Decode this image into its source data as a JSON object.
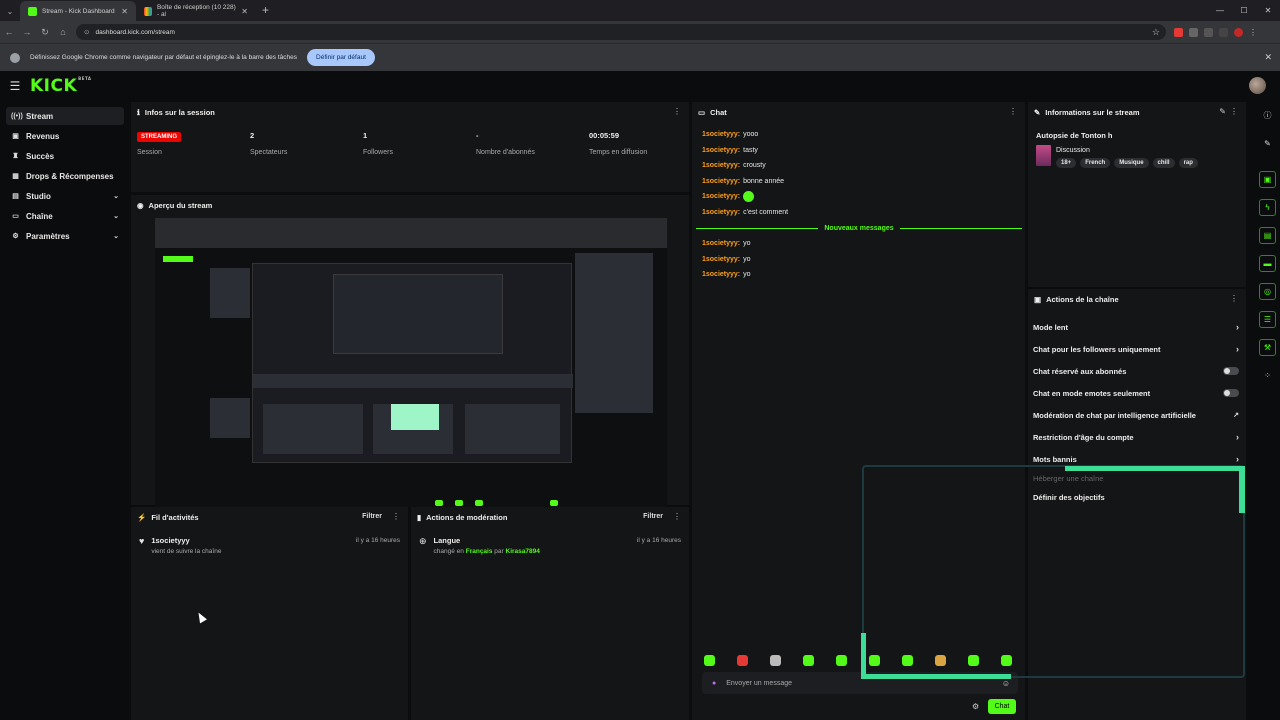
{
  "browser": {
    "tabs": [
      {
        "title": "Stream - Kick Dashboard",
        "active": true
      },
      {
        "title": "Boîte de réception (10 228) - al",
        "active": false
      }
    ],
    "url": "dashboard.kick.com/stream",
    "infobar_text": "Définissez Google Chrome comme navigateur par défaut et épinglez-le à la barre des tâches",
    "infobar_button": "Définir par défaut"
  },
  "header": {
    "logo": "KICK",
    "logo_badge": "BETA"
  },
  "sidebar": {
    "items": [
      {
        "label": "Stream",
        "icon": "broadcast-icon",
        "active": true
      },
      {
        "label": "Revenus",
        "icon": "money-icon"
      },
      {
        "label": "Succès",
        "icon": "trophy-icon"
      },
      {
        "label": "Drops & Récompenses",
        "icon": "gift-icon"
      },
      {
        "label": "Studio",
        "icon": "studio-icon",
        "expandable": true
      },
      {
        "label": "Chaîne",
        "icon": "channel-icon",
        "expandable": true
      },
      {
        "label": "Paramètres",
        "icon": "gear-icon",
        "expandable": true
      }
    ]
  },
  "session": {
    "title": "Infos sur la session",
    "status_badge": "STREAMING",
    "stats": [
      {
        "value": "",
        "label": "Session"
      },
      {
        "value": "2",
        "label": "Spectateurs"
      },
      {
        "value": "1",
        "label": "Followers"
      },
      {
        "value": "-",
        "label": "Nombre d'abonnés"
      },
      {
        "value": "00:05:59",
        "label": "Temps en diffusion"
      }
    ]
  },
  "preview": {
    "title": "Aperçu du stream"
  },
  "activity": {
    "title": "Fil d'activités",
    "filter": "Filtrer",
    "items": [
      {
        "user": "1societyyy",
        "text": "vient de suivre la chaîne",
        "time": "il y a 16 heures"
      }
    ]
  },
  "moderation": {
    "title": "Actions de modération",
    "filter": "Filtrer",
    "items": [
      {
        "title": "Langue",
        "pre": "changé en",
        "lang": "Français",
        "by": "par",
        "mod": "Kirasa7894",
        "time": "il y a 16 heures"
      }
    ]
  },
  "chat": {
    "title": "Chat",
    "messages_before": [
      {
        "user": "1societyyy:",
        "text": "yooo"
      },
      {
        "user": "1societyyy:",
        "text": "tasty"
      },
      {
        "user": "1societyyy:",
        "text": "crousty"
      },
      {
        "user": "1societyyy:",
        "text": "bonne année"
      },
      {
        "user": "1societyyy:",
        "text": "",
        "emote": true
      },
      {
        "user": "1societyyy:",
        "text": "c'est comment"
      }
    ],
    "divider": "Nouveaux messages",
    "messages_after": [
      {
        "user": "1societyyy:",
        "text": "yo"
      },
      {
        "user": "1societyyy:",
        "text": "yo"
      },
      {
        "user": "1societyyy:",
        "text": "yo"
      }
    ],
    "input_placeholder": "Envoyer un message",
    "send_label": "Chat"
  },
  "stream_info": {
    "title": "Informations sur le stream",
    "stream_title": "Autopsie de Tonton h",
    "category": "Discussion",
    "tags": [
      "18+",
      "French",
      "Musique",
      "chill",
      "rap"
    ]
  },
  "channel_actions": {
    "title": "Actions de la chaîne",
    "items": [
      {
        "label": "Mode lent",
        "control": "chevron"
      },
      {
        "label": "Chat pour les followers uniquement",
        "control": "chevron"
      },
      {
        "label": "Chat réservé aux abonnés",
        "control": "toggle"
      },
      {
        "label": "Chat en mode emotes seulement",
        "control": "toggle"
      },
      {
        "label": "Modération de chat par intelligence artificielle",
        "control": "chart"
      },
      {
        "label": "Restriction d'âge du compte",
        "control": "chevron"
      },
      {
        "label": "Mots bannis",
        "control": "chevron"
      },
      {
        "label": "Héberger une chaîne",
        "control": "none",
        "faded": true
      },
      {
        "label": "Définir des objectifs",
        "control": "none"
      }
    ]
  },
  "colors": {
    "accent": "#53fc18",
    "live": "#eb0400",
    "username": "#ff9f1a"
  }
}
